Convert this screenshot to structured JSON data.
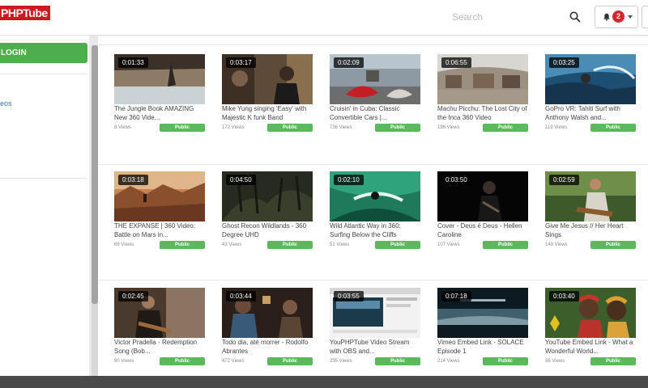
{
  "header": {
    "logo_text": "PHPTube",
    "search_placeholder": "Search",
    "notification_count": "2"
  },
  "sidebar": {
    "login_label": "LOGIN",
    "link_label": "eos"
  },
  "videos": [
    {
      "duration": "0:01:33",
      "title": "The Jungle Book AMAZING New 360 Vide...",
      "views": "8 Views",
      "status": "Public"
    },
    {
      "duration": "0:03:17",
      "title": "Mike Yung singing 'Easy' with Majestic K funk Band",
      "views": "172 Views",
      "status": "Public"
    },
    {
      "duration": "0:02:09",
      "title": "Cruisin' in Cuba: Classic Convertible Cars |...",
      "views": "736 Views",
      "status": "Public"
    },
    {
      "duration": "0:06:55",
      "title": "Machu Picchu: The Lost City of the Inca 360 Video",
      "views": "196 Views",
      "status": "Public"
    },
    {
      "duration": "0:03:25",
      "title": "GoPro VR: Tahiti Surf with Anthony Walsh and...",
      "views": "119 Views",
      "status": "Public"
    },
    {
      "duration": "0:03:18",
      "title": "THE EXPANSE | 360 Video: Battle on Mars in...",
      "views": "69 Views",
      "status": "Public"
    },
    {
      "duration": "0:04:50",
      "title": "Ghost Recon Wildlands - 360 Degree UHD",
      "views": "43 Views",
      "status": "Public"
    },
    {
      "duration": "0:02:10",
      "title": "Wild Atlantic Way in 360: Surfing Below the Cliffs",
      "views": "51 Views",
      "status": "Public"
    },
    {
      "duration": "0:03:50",
      "title": "Cover - Deus é Deus - Hellen Caroline",
      "views": "107 Views",
      "status": "Public"
    },
    {
      "duration": "0:02:59",
      "title": "Give Me Jesus // Her Heart Sings",
      "views": "149 Views",
      "status": "Public"
    },
    {
      "duration": "0:02:45",
      "title": "Victor Pradella - Redemption Song (Bob...",
      "views": "90 Views",
      "status": "Public"
    },
    {
      "duration": "0:03:44",
      "title": "Todo dia, até morrer - Rodolfo Abrantes",
      "views": "472 Views",
      "status": "Public"
    },
    {
      "duration": "0:03:55",
      "title": "YouPHPTube Video Stream with OBS and...",
      "views": "235 Views",
      "status": "Public"
    },
    {
      "duration": "0:07:18",
      "title": "Vimeo Embed Link - SOLACE Episode 1",
      "views": "214 Views",
      "status": "Public"
    },
    {
      "duration": "0:03:40",
      "title": "YouTube Embed Link - What a Wonderful World...",
      "views": "36 Views",
      "status": "Public"
    }
  ],
  "colors": {
    "brand": "#cc181e",
    "login_green": "#4cae4c",
    "public_badge": "#5cb85c",
    "badge_red": "#d9232d",
    "link_blue": "#337ab7"
  }
}
